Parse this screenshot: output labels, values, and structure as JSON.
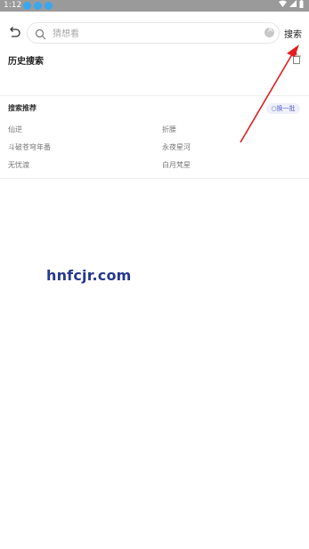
{
  "status_bar": {
    "time": "1:12"
  },
  "header": {
    "search_placeholder": "猜想看",
    "search_button": "搜索"
  },
  "history": {
    "title": "历史搜索"
  },
  "recommend": {
    "title": "搜索推荐",
    "refresh": "换一批",
    "items": [
      "仙逆",
      "折腰",
      "斗破苍穹年番",
      "永夜星河",
      "无忧渡",
      "白月梵星"
    ]
  },
  "watermark": "hnfcjr.com",
  "colors": {
    "accent": "#5a63c9",
    "annotation": "#e31e1e"
  }
}
